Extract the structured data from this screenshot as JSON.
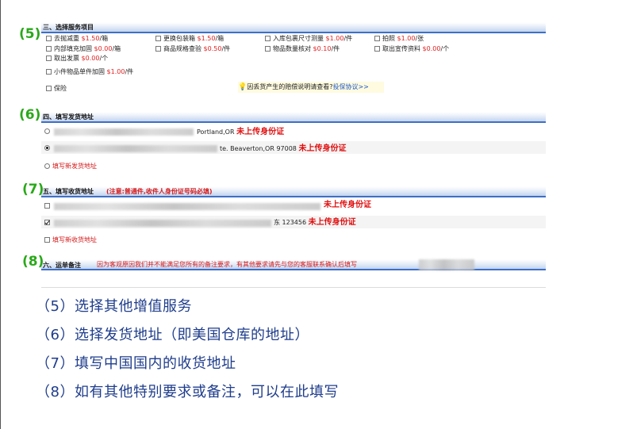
{
  "numbers": {
    "n5": "(5)",
    "n6": "(6)",
    "n7": "(7)",
    "n8": "(8)"
  },
  "section3": {
    "title": "三、选择服务项目",
    "options": [
      {
        "label": "去抛减重",
        "price": "$1.50",
        "unit": "/箱"
      },
      {
        "label": "更换包装箱",
        "price": "$1.50",
        "unit": "/箱"
      },
      {
        "label": "入库包裹尺寸测量",
        "price": "$1.00",
        "unit": "/件"
      },
      {
        "label": "拍照",
        "price": "$1.00",
        "unit": "/张"
      },
      {
        "label": "内部填充加固",
        "price": "$0.00",
        "unit": "/箱"
      },
      {
        "label": "商品规格查验",
        "price": "$0.50",
        "unit": "/件"
      },
      {
        "label": "物品数量核对",
        "price": "$0.10",
        "unit": "/件"
      },
      {
        "label": "取出宣传资料",
        "price": "$0.00",
        "unit": "/个"
      },
      {
        "label": "取出发票",
        "price": "$0.00",
        "unit": "/个"
      },
      {
        "label": "小件物品单件加固",
        "price": "$1.00",
        "unit": "/件"
      }
    ],
    "insurance": "保险",
    "tip_text": "因丢货产生的赔偿说明请查看?",
    "tip_link": "投保协议>>"
  },
  "section4": {
    "title": "四、填写发货地址",
    "addresses": [
      {
        "visible": "Portland,OR",
        "warn": "未上传身份证"
      },
      {
        "visible": "te. Beaverton,OR 97008",
        "warn": "未上传身份证"
      }
    ],
    "new_label": "填写新发货地址"
  },
  "section5": {
    "title": "五、填写收货地址",
    "note": "(注意:普通件,收件人身份证号码必填)",
    "addresses": [
      {
        "visible": "",
        "warn": "未上传身份证"
      },
      {
        "visible": "东 123456",
        "warn": "未上传身份证"
      }
    ],
    "new_label": "填写新收货地址"
  },
  "section6": {
    "title": "六、运单备注",
    "note": "因为客观原因我们并不能满足您所有的备注要求，有其他要求请先与您的客服联系确认后填写"
  },
  "captions": [
    "（5）选择其他增值服务",
    "（6）选择发货地址（即美国仓库的地址）",
    "（7）填写中国国内的收货地址",
    "（8）如有其他特别要求或备注，可以在此填写"
  ]
}
